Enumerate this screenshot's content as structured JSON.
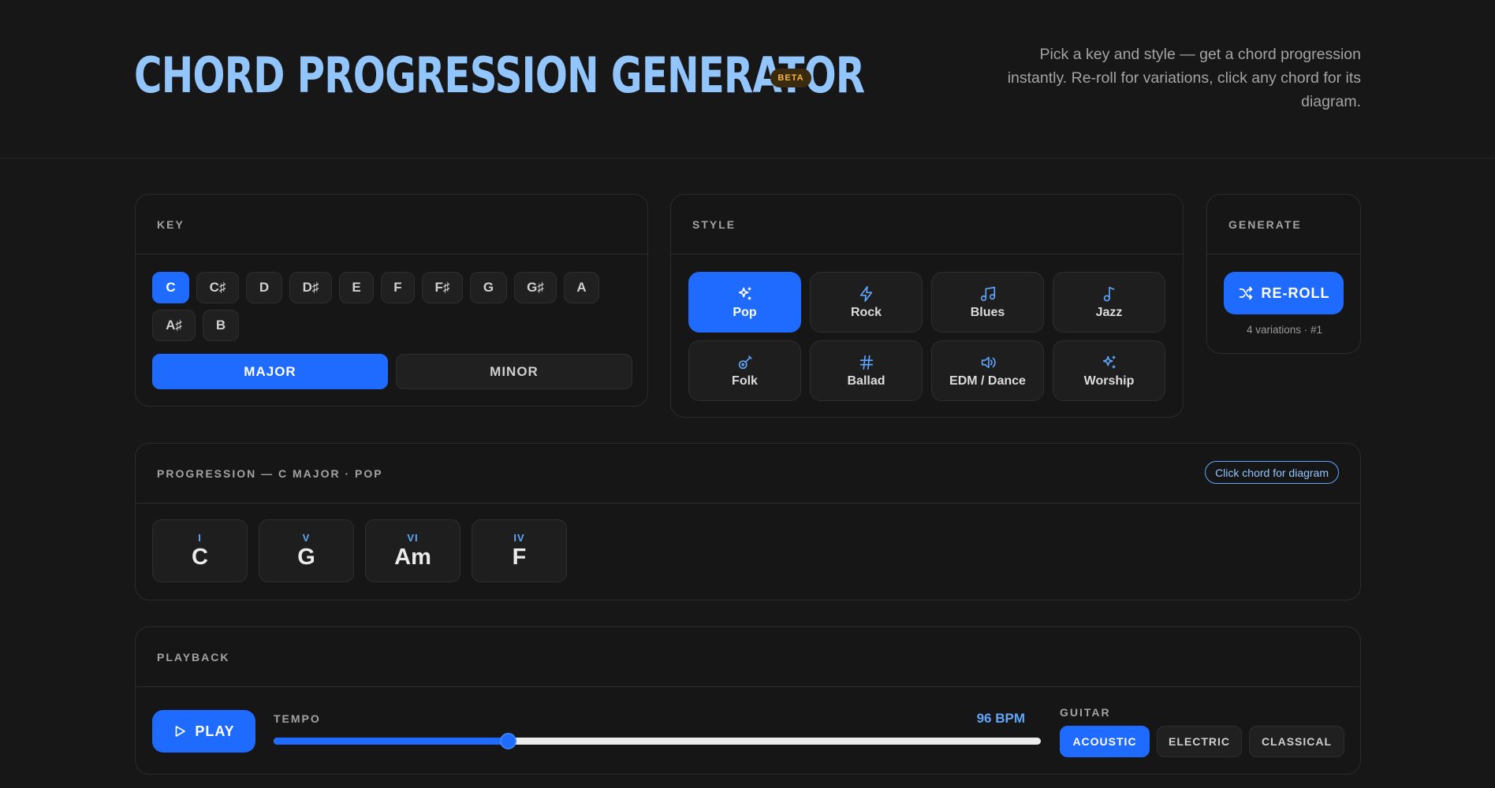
{
  "header": {
    "title": "CHORD PROGRESSION GENERATOR",
    "badge": "BETA",
    "tagline": "Pick a key and style — get a chord progression instantly. Re-roll for variations, click any chord for its diagram."
  },
  "key": {
    "heading": "KEY",
    "keys": [
      "C",
      "C♯",
      "D",
      "D♯",
      "E",
      "F",
      "F♯",
      "G",
      "G♯",
      "A",
      "A♯",
      "B"
    ],
    "selected": "C",
    "modes": [
      "MAJOR",
      "MINOR"
    ],
    "selected_mode": "MAJOR"
  },
  "style": {
    "heading": "STYLE",
    "options": [
      {
        "label": "Pop",
        "icon": "sparkles-icon"
      },
      {
        "label": "Rock",
        "icon": "lightning-icon"
      },
      {
        "label": "Blues",
        "icon": "music-notes-icon"
      },
      {
        "label": "Jazz",
        "icon": "music-note-icon"
      },
      {
        "label": "Folk",
        "icon": "guitar-icon"
      },
      {
        "label": "Ballad",
        "icon": "hash-icon"
      },
      {
        "label": "EDM / Dance",
        "icon": "speaker-icon"
      },
      {
        "label": "Worship",
        "icon": "sparkles-icon"
      }
    ],
    "selected": "Pop"
  },
  "generate": {
    "heading": "GENERATE",
    "button_label": "RE-ROLL",
    "variations_text": "4 variations · #1"
  },
  "progression": {
    "heading": "PROGRESSION — C MAJOR · POP",
    "hint": "Click chord for diagram",
    "chords": [
      {
        "numeral": "I",
        "name": "C"
      },
      {
        "numeral": "V",
        "name": "G"
      },
      {
        "numeral": "VI",
        "name": "Am"
      },
      {
        "numeral": "IV",
        "name": "F"
      }
    ]
  },
  "playback": {
    "heading": "PLAYBACK",
    "play_label": "PLAY",
    "tempo_label": "TEMPO",
    "bpm_text": "96 BPM",
    "tempo_fraction": 0.305,
    "guitar_label": "GUITAR",
    "guitar_options": [
      "ACOUSTIC",
      "ELECTRIC",
      "CLASSICAL"
    ],
    "guitar_selected": "ACOUSTIC"
  },
  "colors": {
    "accent": "#1f6bff",
    "title": "#93c5fd",
    "background": "#171717"
  }
}
